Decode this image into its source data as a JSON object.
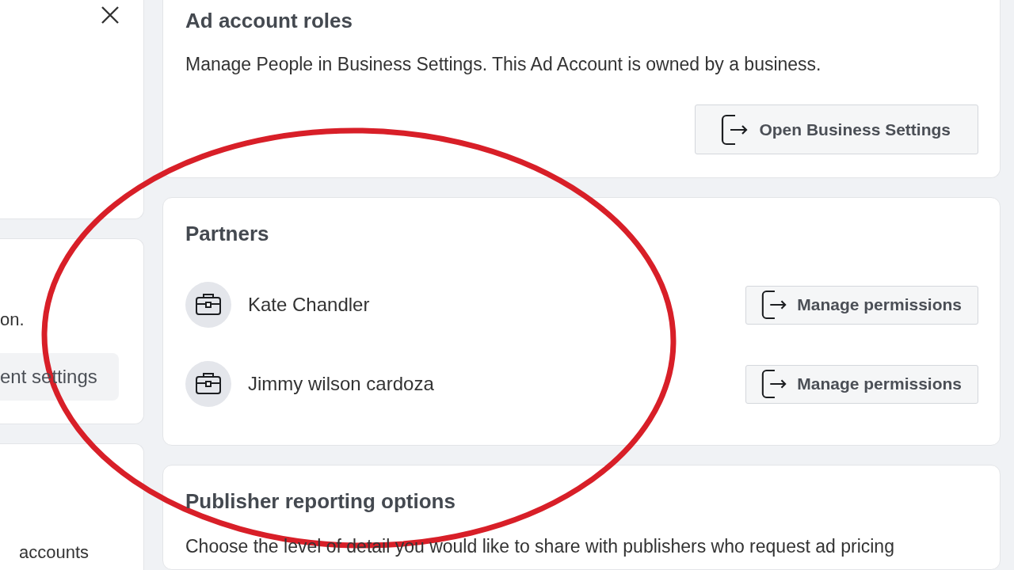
{
  "left_panel": [
    {
      "kind": "close"
    },
    {
      "kind": "text_button",
      "text": "on.",
      "button": "ent settings"
    },
    {
      "kind": "text",
      "text": "accounts"
    }
  ],
  "ad_account_roles": {
    "title": "Ad account roles",
    "description": "Manage People in Business Settings. This Ad Account is owned by a business.",
    "button": "Open Business Settings"
  },
  "partners": {
    "title": "Partners",
    "items": [
      {
        "name": "Kate Chandler",
        "button": "Manage permissions"
      },
      {
        "name": "Jimmy wilson cardoza",
        "button": "Manage permissions"
      }
    ]
  },
  "publisher_reporting": {
    "title": "Publisher reporting options",
    "description": "Choose the level of detail you would like to share with publishers who request ad pricing"
  }
}
